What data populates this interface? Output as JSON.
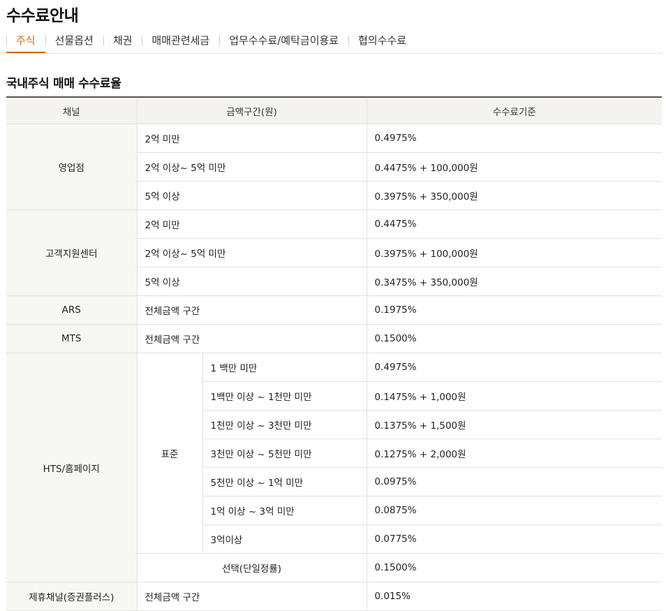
{
  "page": {
    "title": "수수료안내"
  },
  "tabs": [
    {
      "label": "주식",
      "active": true
    },
    {
      "label": "선물옵션",
      "active": false
    },
    {
      "label": "채권",
      "active": false
    },
    {
      "label": "매매관련세금",
      "active": false
    },
    {
      "label": "업무수수료/예탁금이용료",
      "active": false
    },
    {
      "label": "협의수수료",
      "active": false
    }
  ],
  "section": {
    "title": "국내주식 매매 수수료율"
  },
  "table": {
    "headers": {
      "channel": "채널",
      "range": "금액구간(원)",
      "rate": "수수료기준"
    },
    "branch": {
      "channel": "영업점",
      "rows": [
        {
          "range": "2억 미만",
          "rate": "0.4975%"
        },
        {
          "range": "2억 이상~ 5억 미만",
          "rate": "0.4475% + 100,000원"
        },
        {
          "range": "5억 이상",
          "rate": "0.3975% + 350,000원"
        }
      ]
    },
    "support": {
      "channel": "고객지원센터",
      "rows": [
        {
          "range": "2억 미만",
          "rate": "0.4475%"
        },
        {
          "range": "2억 이상~ 5억 미만",
          "rate": "0.3975% + 100,000원"
        },
        {
          "range": "5억 이상",
          "rate": "0.3475% + 350,000원"
        }
      ]
    },
    "ars": {
      "channel": "ARS",
      "range": "전체금액 구간",
      "rate": "0.1975%"
    },
    "mts": {
      "channel": "MTS",
      "range": "전체금액 구간",
      "rate": "0.1500%"
    },
    "hts": {
      "channel": "HTS/홈페이지",
      "standard_label": "표준",
      "rows": [
        {
          "range": "1 백만 미만",
          "rate": "0.4975%"
        },
        {
          "range": "1백만 이상 ~ 1천만 미만",
          "rate": "0.1475% + 1,000원"
        },
        {
          "range": "1천만 이상 ~ 3천만 미만",
          "rate": "0.1375% + 1,500원"
        },
        {
          "range": "3천만 이상 ~ 5천만 미만",
          "rate": "0.1275% + 2,000원"
        },
        {
          "range": "5천만 이상 ~ 1억 미만",
          "rate": "0.0975%"
        },
        {
          "range": "1억 이상 ~ 3억 미만",
          "rate": "0.0875%"
        },
        {
          "range": "3억이상",
          "rate": "0.0775%"
        }
      ],
      "flat": {
        "label": "선택(단일정률)",
        "rate": "0.1500%"
      }
    },
    "partner": {
      "channel": "제휴채널(증권플러스)",
      "range": "전체금액 구간",
      "rate": "0.015%"
    }
  }
}
